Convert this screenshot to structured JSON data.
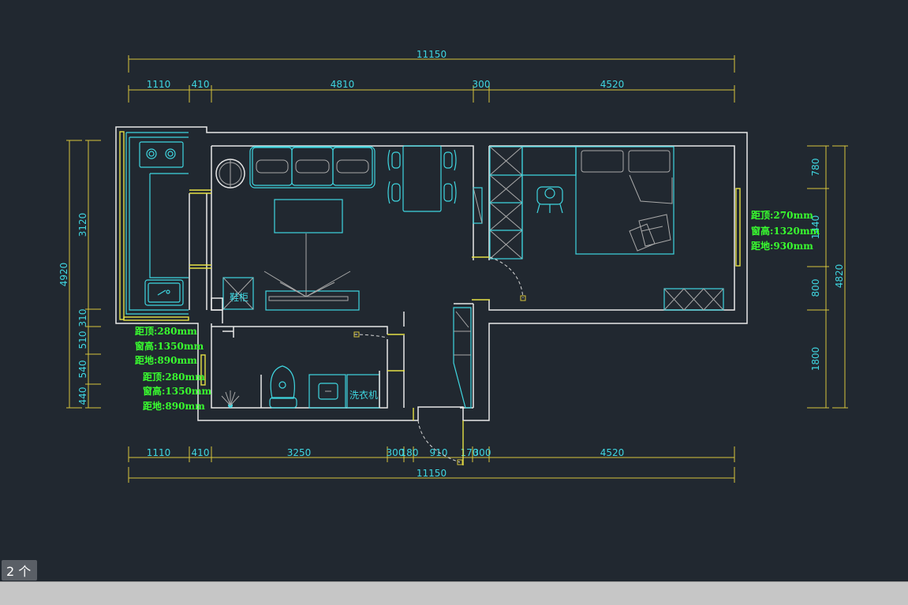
{
  "plan": {
    "top_total": "11150",
    "top_segments": [
      "1110",
      "410",
      "4810",
      "300",
      "4520"
    ],
    "bottom_total": "11150",
    "bottom_segments": [
      "1110",
      "410",
      "3250",
      "300",
      "180",
      "910",
      "170",
      "300",
      "4520"
    ],
    "left_total": "4920",
    "left_segments": [
      "3120",
      "310",
      "510",
      "540",
      "440"
    ],
    "right_total": "4820",
    "right_segments": [
      "780",
      "1440",
      "800",
      "1800"
    ],
    "left_notes": [
      "距顶:280mm",
      "窗高:1350mm",
      "距地:890mm",
      "距顶:280mm",
      "窗高:1350mm",
      "距地:890mm"
    ],
    "right_notes": [
      "距顶:270mm",
      "窗高:1320mm",
      "距地:930mm"
    ],
    "labels": {
      "appliance": "洗衣机",
      "cabinet": "鞋柜"
    }
  },
  "status": {
    "selection_count": "2 个"
  },
  "colors": {
    "background": "#212830",
    "dimension_text": "#3fd6e0",
    "note_text": "#39ff2f",
    "wall": "#e8e8e8",
    "furniture": "#3fd6e0",
    "dimension_line": "#d6c53b"
  }
}
